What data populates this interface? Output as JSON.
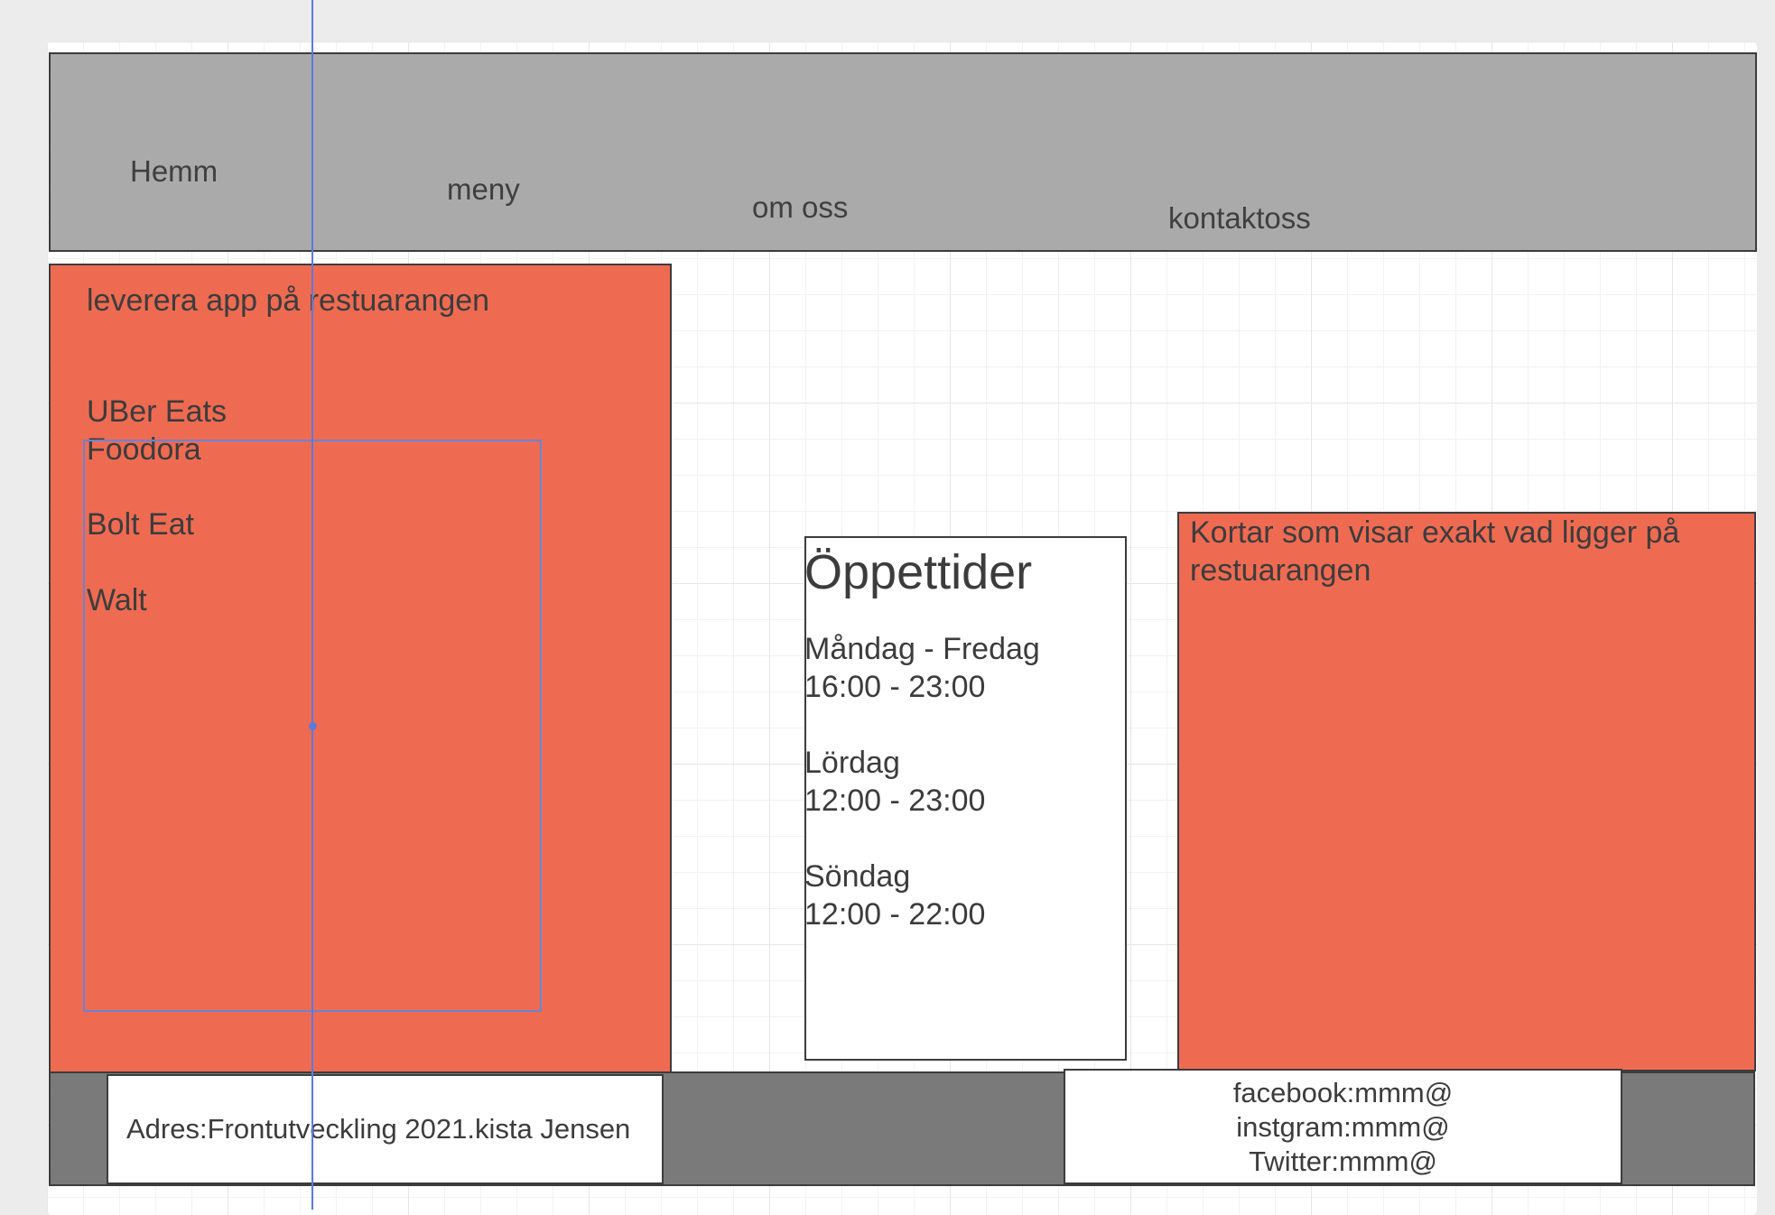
{
  "header": {
    "nav": [
      "Hemm",
      "meny",
      "om oss",
      "kontaktoss"
    ]
  },
  "left_panel": {
    "title": "leverera app på restuarangen",
    "apps": [
      "UBer Eats",
      "Foodora",
      "Bolt Eat",
      "Walt"
    ]
  },
  "hours": {
    "title": "Öppettider",
    "rows": [
      {
        "day": "Måndag - Fredag",
        "time": "16:00 - 23:00"
      },
      {
        "day": "Lördag",
        "time": "12:00 - 23:00"
      },
      {
        "day": "Söndag",
        "time": "12:00 - 22:00"
      }
    ]
  },
  "right_panel": {
    "line1": "Kortar som visar exakt vad ligger på",
    "line2": "restuarangen"
  },
  "footer": {
    "address": "Adres:Frontutveckling 2021.kista Jensen",
    "social": [
      "facebook:mmm@",
      "instgram:mmm@",
      "Twitter:mmm@"
    ]
  },
  "colors": {
    "header_bg": "#aaaaaa",
    "panel_accent": "#ee6b52",
    "footer_bg": "#7a7a7a",
    "selection_blue": "#5b7bd8"
  }
}
